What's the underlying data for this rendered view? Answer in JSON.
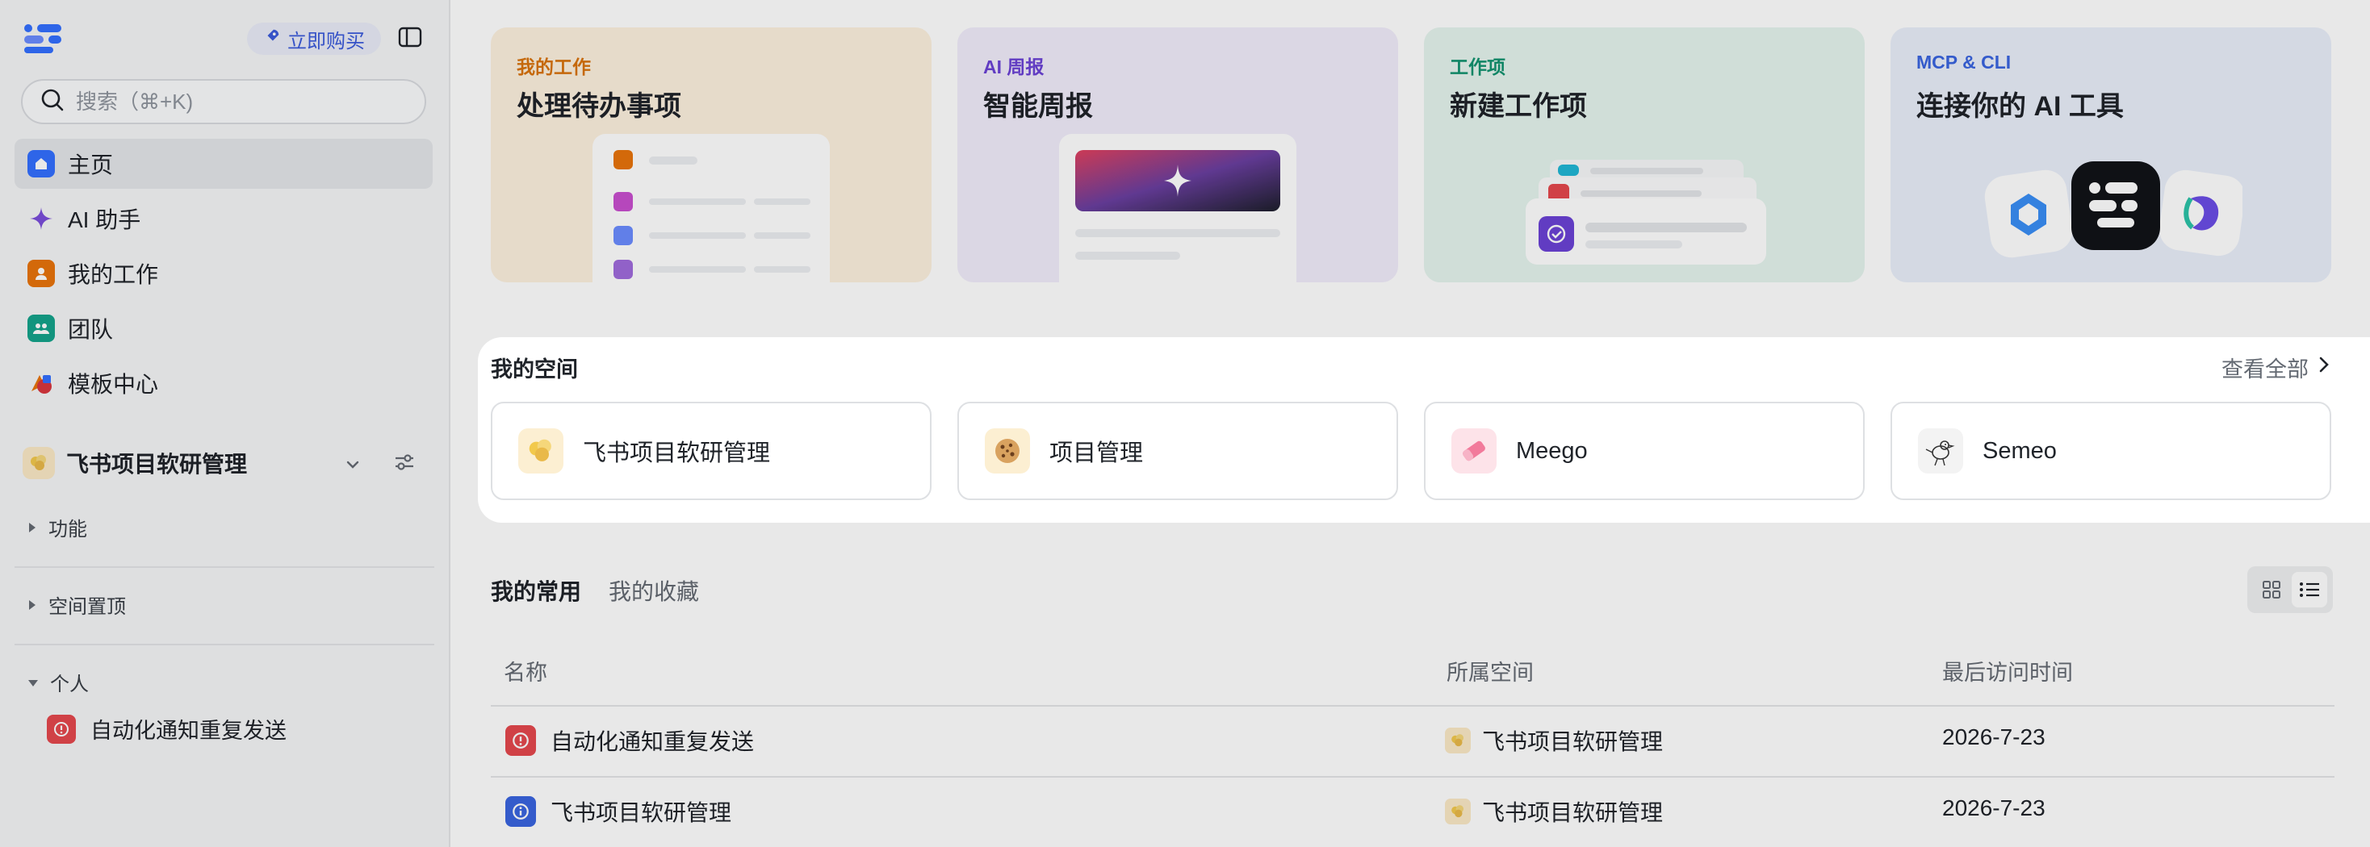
{
  "sidebar": {
    "buy_label": "立即购买",
    "search_placeholder": "搜索（⌘+K)",
    "nav": [
      {
        "label": "主页",
        "icon": "home-icon",
        "color": "#3370ff"
      },
      {
        "label": "AI 助手",
        "icon": "sparkle-icon",
        "color": "#7b4ddb"
      },
      {
        "label": "我的工作",
        "icon": "person-icon",
        "color": "#e8740c"
      },
      {
        "label": "团队",
        "icon": "team-icon",
        "color": "#14a38b"
      },
      {
        "label": "模板中心",
        "icon": "template-icon",
        "color": "#d9363e"
      }
    ],
    "space_name": "飞书项目软研管理",
    "sections": {
      "features": "功能",
      "pinned": "空间置顶",
      "personal": "个人"
    },
    "personal_items": [
      {
        "label": "自动化通知重复发送",
        "icon": "alert-icon",
        "color": "#e5484d"
      }
    ]
  },
  "cards": [
    {
      "tag": "我的工作",
      "title": "处理待办事项",
      "tag_color": "#d9730d",
      "bg": "#fdf3e4"
    },
    {
      "tag": "AI 周报",
      "title": "智能周报",
      "tag_color": "#6b42d6",
      "bg": "#f1eefb"
    },
    {
      "tag": "工作项",
      "title": "新建工作项",
      "tag_color": "#12936f",
      "bg": "#e7f5f0"
    },
    {
      "tag": "MCP & CLI",
      "title": "连接你的 AI 工具",
      "tag_color": "#3a64e0",
      "bg": "#ebf0fb"
    }
  ],
  "spaces": {
    "title": "我的空间",
    "view_all": "查看全部",
    "items": [
      {
        "label": "飞书项目软研管理",
        "icon": "popcorn-icon",
        "bg": "#fcefd2"
      },
      {
        "label": "项目管理",
        "icon": "cookie-icon",
        "bg": "#fcefd2"
      },
      {
        "label": "Meego",
        "icon": "eraser-icon",
        "bg": "#fde3e9"
      },
      {
        "label": "Semeo",
        "icon": "bird-icon",
        "bg": "#f3f3f3"
      }
    ]
  },
  "recent": {
    "tabs": [
      "我的常用",
      "我的收藏"
    ],
    "columns": [
      "名称",
      "所属空间",
      "最后访问时间"
    ],
    "rows": [
      {
        "name": "自动化通知重复发送",
        "icon": "alert-icon",
        "color": "#e5484d",
        "space": "飞书项目软研管理",
        "time": "2026-7-23"
      },
      {
        "name": "飞书项目软研管理",
        "icon": "info-icon",
        "color": "#3a64e0",
        "space": "飞书项目软研管理",
        "time": "2026-7-23"
      }
    ]
  }
}
